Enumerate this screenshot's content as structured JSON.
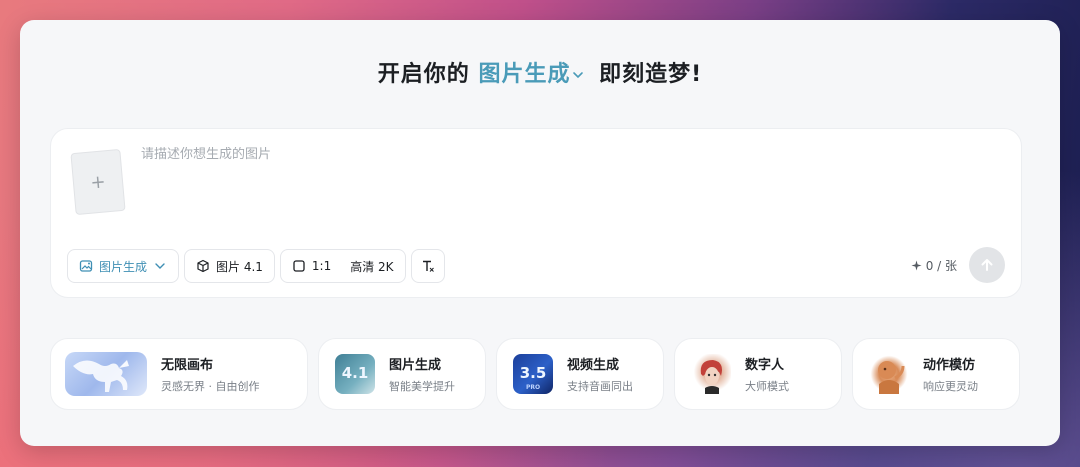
{
  "headline": {
    "prefix": "开启你的",
    "mode": "图片生成",
    "suffix": "即刻造梦!"
  },
  "composer": {
    "upload_icon": "plus-icon",
    "prompt_placeholder": "请描述你想生成的图片",
    "prompt_value": "",
    "chips": {
      "mode_label": "图片生成",
      "model_label": "图片 4.1",
      "ratio_label": "1:1",
      "quality_label": "高清 2K"
    },
    "credits": "0 / 张"
  },
  "features": [
    {
      "title": "无限画布",
      "subtitle": "灵感无界 · 自由创作",
      "icon": "pegasus-thumbnail"
    },
    {
      "title": "图片生成",
      "subtitle": "智能美学提升",
      "icon": "image-gen-thumbnail",
      "badge": "4.1"
    },
    {
      "title": "视频生成",
      "subtitle": "支持音画同出",
      "icon": "video-gen-thumbnail",
      "badge": "3.5",
      "badge_sub": "PRO"
    },
    {
      "title": "数字人",
      "subtitle": "大师模式",
      "icon": "digital-human-thumbnail"
    },
    {
      "title": "动作模仿",
      "subtitle": "响应更灵动",
      "icon": "motion-mimic-thumbnail"
    }
  ],
  "colors": {
    "accent": "#4a9bb8",
    "card_bg": "#f6f7f9",
    "send_disabled": "#e2e4e7"
  }
}
